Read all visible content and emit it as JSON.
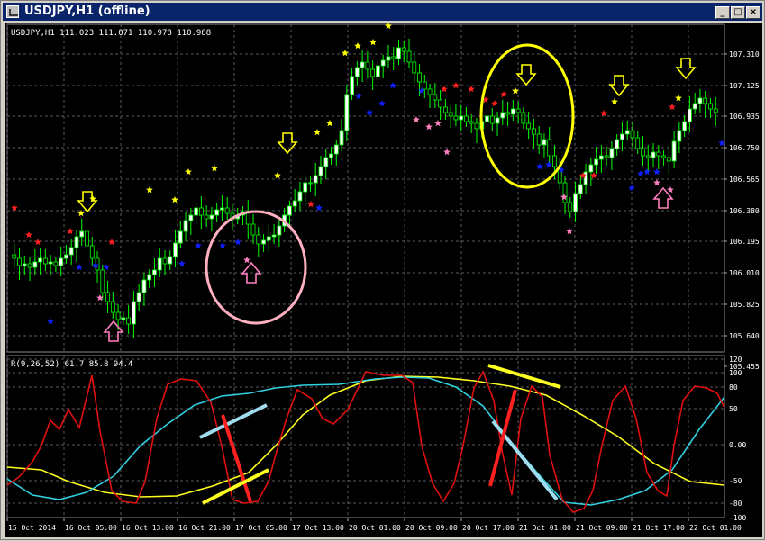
{
  "window": {
    "title": "USDJPY,H1 (offline)",
    "minimize_glyph": "_",
    "maximize_glyph": "□",
    "close_glyph": "×"
  },
  "main_chart": {
    "info": "USDJPY,H1  111.023 111.071 110.978 110.988",
    "price_ticks": [
      "107.310",
      "107.125",
      "106.935",
      "106.750",
      "106.565",
      "106.380",
      "106.195",
      "106.010",
      "105.825",
      "105.640",
      "105.455"
    ]
  },
  "indicator": {
    "info": "R(9,26,52) 61.7 85.8 94.4",
    "ticks": [
      "120",
      "100",
      "80",
      "50",
      "0.00",
      "-50",
      "-80",
      "-100"
    ]
  },
  "time_axis": [
    "15 Oct 2014",
    "16 Oct 05:00",
    "16 Oct 13:00",
    "16 Oct 21:00",
    "17 Oct 05:00",
    "17 Oct 13:00",
    "20 Oct 01:00",
    "20 Oct 09:00",
    "20 Oct 17:00",
    "21 Oct 01:00",
    "21 Oct 09:00",
    "21 Oct 17:00",
    "22 Oct 01:00"
  ],
  "colors": {
    "background": "#000000",
    "grid": "#5a5a5a",
    "candle": "#00ff00",
    "bull_body": "#ffffff",
    "star_yellow": "#ffff00",
    "star_red": "#ff2020",
    "star_blue": "#1020ff",
    "star_pink": "#ff80c0",
    "line_red": "#e01010",
    "line_cyan": "#30d0e0",
    "line_yellow": "#ffff20",
    "circle_pink": "#ffb0c0",
    "circle_yellow": "#ffff00"
  }
}
